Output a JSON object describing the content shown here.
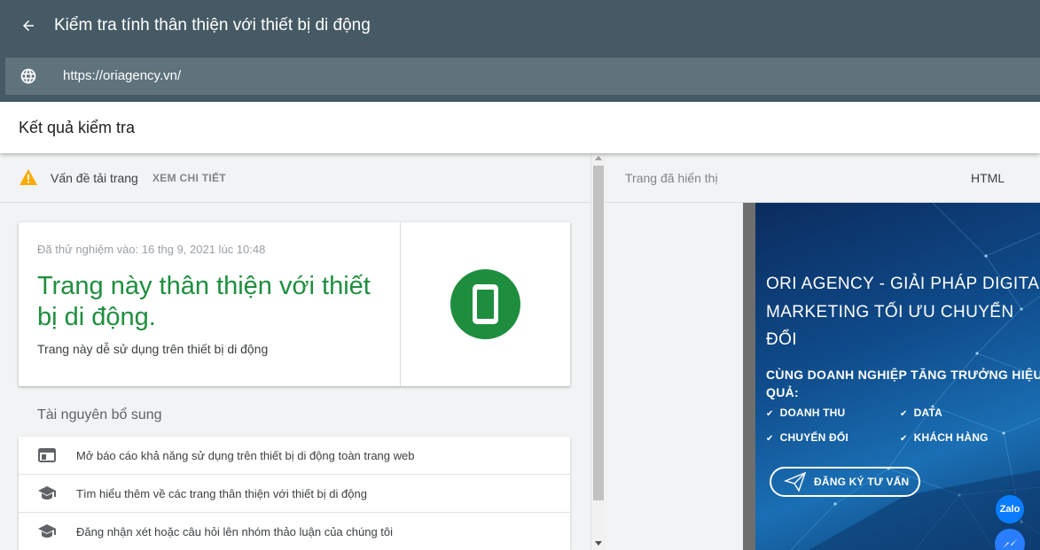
{
  "header": {
    "title": "Kiểm tra tính thân thiện với thiết bị di động",
    "url": "https://oriagency.vn/"
  },
  "results": {
    "title": "Kết quả kiểm tra"
  },
  "issues": {
    "text": "Vấn đề tải trang",
    "link": "XEM CHI TIẾT"
  },
  "result_card": {
    "tested_at": "Đã thử nghiệm vào: 16 thg 9, 2021 lúc 10:48",
    "headline": "Trang này thân thiện với thiết bị di động.",
    "subtitle": "Trang này dễ sử dụng trên thiết bị di động"
  },
  "resources": {
    "title": "Tài nguyên bổ sung",
    "items": [
      {
        "label": "Mở báo cáo khả năng sử dụng trên thiết bị di động toàn trang web",
        "icon": "web-report-icon"
      },
      {
        "label": "Tìm hiểu thêm về các trang thân thiện với thiết bị di động",
        "icon": "school-icon"
      },
      {
        "label": "Đăng nhận xét hoặc câu hỏi lên nhóm thảo luận của chúng tôi",
        "icon": "school-icon"
      }
    ]
  },
  "right_pane": {
    "tab_rendered": "Trang đã hiển thị",
    "tab_html": "HTML"
  },
  "preview": {
    "headline": "ORI AGENCY - GIẢI PHÁP DIGITAL MARKETING TỐI ƯU CHUYỂN ĐỔI",
    "subhead": "CÙNG DOANH NGHIỆP TĂNG TRƯỞNG HIỆU QUẢ:",
    "checks": [
      "DOANH THU",
      "DATA",
      "CHUYỂN ĐỔI",
      "KHÁCH HÀNG"
    ],
    "cta": "ĐĂNG KÝ TƯ VẤN",
    "zalo": "Zalo"
  },
  "colors": {
    "topbar": "#455a64",
    "urlbar": "#5f737c",
    "success_green": "#1e8e3e",
    "warning": "#f9ab00"
  }
}
